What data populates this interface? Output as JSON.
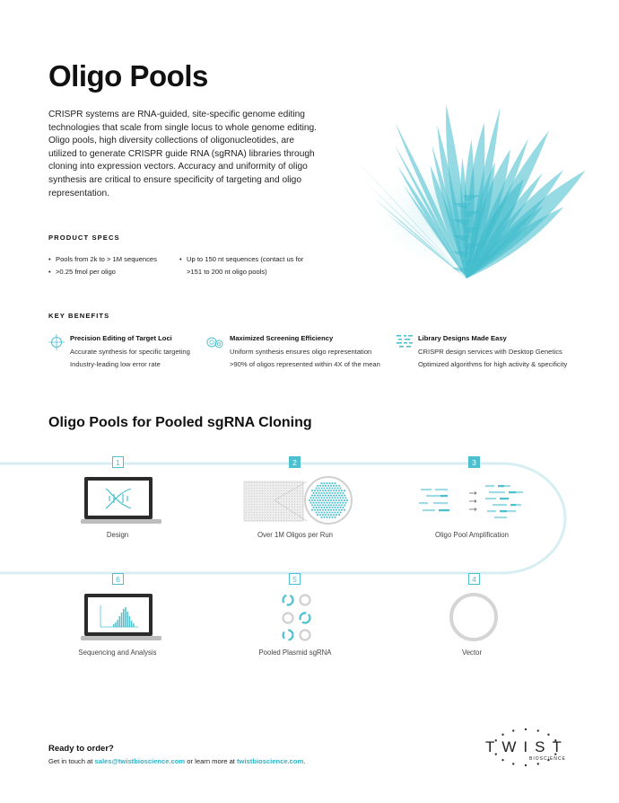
{
  "page": {
    "title": "Oligo Pools",
    "intro": "CRISPR systems are RNA-guided, site-specific genome editing technologies that scale from single locus to whole genome editing. Oligo pools, high diversity collections of oligonucleotides, are utilized to generate CRISPR guide RNA (sgRNA) libraries through cloning into expression vectors. Accuracy and uniformity of oligo synthesis are critical to ensure specificity of targeting and oligo representation."
  },
  "specs": {
    "heading": "PRODUCT SPECS",
    "col1": [
      "Pools from 2k to > 1M sequences",
      ">0.25 fmol per oligo"
    ],
    "col2_line1": "Up to 150 nt sequences (contact us for",
    "col2_line2": ">151 to 200 nt oligo pools)"
  },
  "benefits": {
    "heading": "KEY BENEFITS",
    "items": [
      {
        "icon": "crosshair-icon",
        "title": "Precision Editing of Target Loci",
        "lines": [
          "Accurate synthesis for specific targeting",
          "Industry-leading low error rate"
        ]
      },
      {
        "icon": "circles-icon",
        "title": "Maximized Screening Efficiency",
        "lines": [
          "Uniform synthesis ensures oligo representation",
          ">90% of oligos represented within 4X of the mean"
        ]
      },
      {
        "icon": "library-icon",
        "title": "Library Designs Made Easy",
        "lines": [
          "CRISPR design services with Desktop Genetics",
          "Optimized algorithms for high activity & specificity"
        ]
      }
    ]
  },
  "workflow": {
    "heading": "Oligo Pools for Pooled sgRNA Cloning",
    "steps": [
      {
        "num": "1",
        "label": "Design"
      },
      {
        "num": "2",
        "label": "Over 1M Oligos per Run"
      },
      {
        "num": "3",
        "label": "Oligo Pool Amplification"
      },
      {
        "num": "4",
        "label": "Vector"
      },
      {
        "num": "5",
        "label": "Pooled Plasmid sgRNA"
      },
      {
        "num": "6",
        "label": "Sequencing and Analysis"
      }
    ]
  },
  "cta": {
    "title": "Ready to order?",
    "prefix": "Get in touch at ",
    "email": "sales@twistbioscience.com",
    "middle": " or learn more at ",
    "site": "twistbioscience.com",
    "suffix": "."
  },
  "logo": {
    "word": "TWIST",
    "sub": "BIOSCIENCE"
  },
  "colors": {
    "accent": "#4dc0cf",
    "text": "#1a1a1a"
  }
}
